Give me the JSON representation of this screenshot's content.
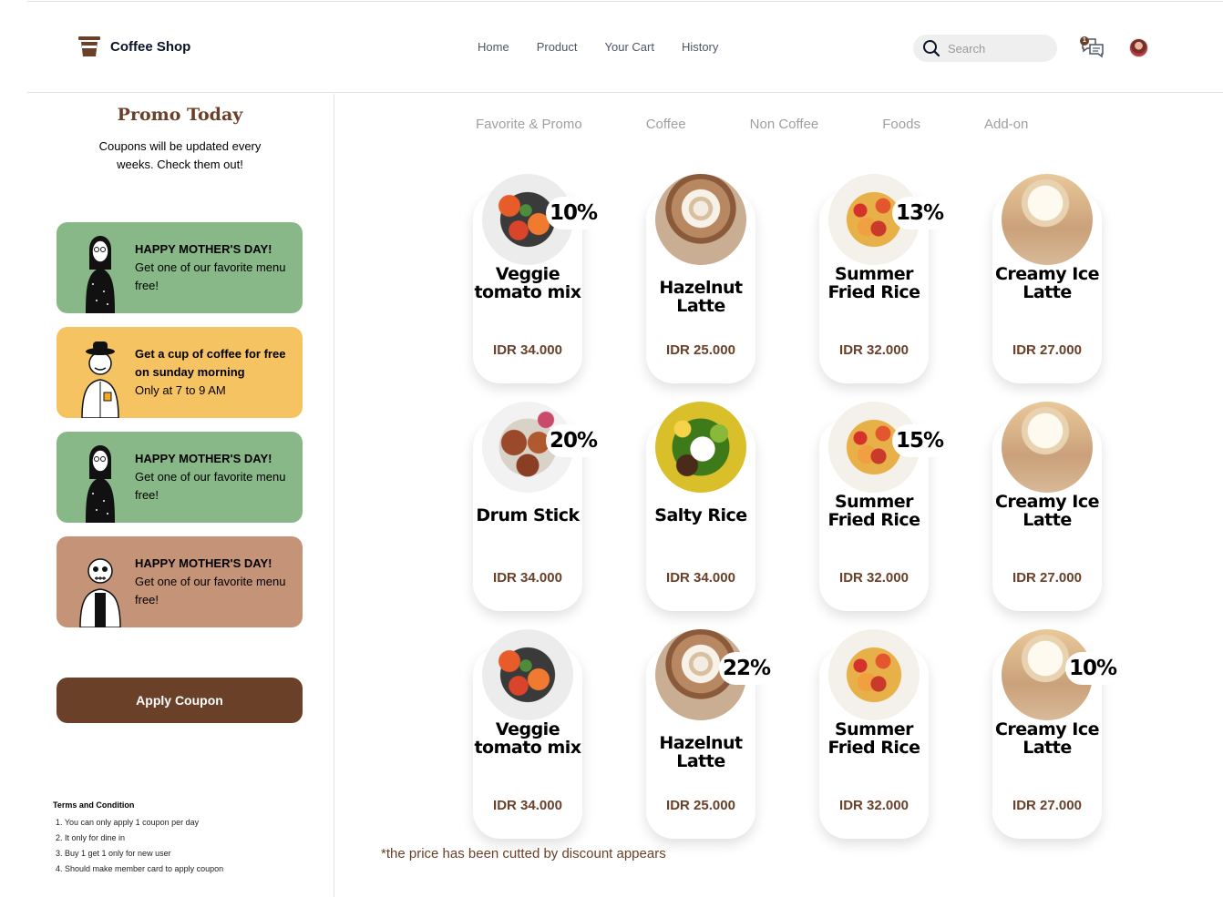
{
  "app": {
    "title": "Coffee Shop"
  },
  "nav": {
    "items": [
      "Home",
      "Product",
      "Your Cart",
      "History"
    ]
  },
  "search": {
    "placeholder": "Search"
  },
  "chat": {
    "badge": "1"
  },
  "promo": {
    "title": "Promo Today",
    "subtitle": "Coupons will be updated every weeks. Check them out!",
    "coupons": [
      {
        "head": "HAPPY MOTHER'S DAY!",
        "body": "Get one of our favorite menu free!",
        "color": "#88b788"
      },
      {
        "head": "Get a cup of coffee for free on sunday morning",
        "body": "Only at 7 to 9 AM",
        "color": "#f5c361"
      },
      {
        "head": "HAPPY MOTHER'S DAY!",
        "body": "Get one of our favorite menu free!",
        "color": "#88b788"
      },
      {
        "head": "HAPPY MOTHER'S DAY!",
        "body": "Get one of our favorite menu free!",
        "color": "#c59378"
      }
    ],
    "apply_label": "Apply Coupon"
  },
  "terms": {
    "title": "Terms and Condition",
    "items": [
      "1. You can only apply 1 coupon per day",
      "2. It only for dine in",
      "3. Buy 1 get 1 only for new user",
      "4. Should make member card to apply coupon"
    ]
  },
  "tabs": [
    "Favorite & Promo",
    "Coffee",
    "Non Coffee",
    "Foods",
    "Add-on"
  ],
  "products": [
    {
      "name": "Veggie tomato mix",
      "price": "IDR 34.000",
      "discount": "10%",
      "image": "veg"
    },
    {
      "name": "Hazelnut Latte",
      "price": "IDR 25.000",
      "discount": "",
      "image": "latte"
    },
    {
      "name": "Summer Fried Rice",
      "price": "IDR 32.000",
      "discount": "13%",
      "image": "rice"
    },
    {
      "name": "Creamy Ice Latte",
      "price": "IDR 27.000",
      "discount": "",
      "image": "icelatte"
    },
    {
      "name": "Drum Stick",
      "price": "IDR 34.000",
      "discount": "20%",
      "image": "drum"
    },
    {
      "name": "Salty Rice",
      "price": "IDR 34.000",
      "discount": "",
      "image": "salty"
    },
    {
      "name": "Summer Fried Rice",
      "price": "IDR 32.000",
      "discount": "15%",
      "image": "rice"
    },
    {
      "name": "Creamy Ice Latte",
      "price": "IDR 27.000",
      "discount": "",
      "image": "icelatte"
    },
    {
      "name": "Veggie tomato mix",
      "price": "IDR 34.000",
      "discount": "",
      "image": "veg"
    },
    {
      "name": "Hazelnut Latte",
      "price": "IDR 25.000",
      "discount": "22%",
      "image": "latte"
    },
    {
      "name": "Summer Fried Rice",
      "price": "IDR 32.000",
      "discount": "",
      "image": "rice"
    },
    {
      "name": "Creamy Ice Latte",
      "price": "IDR 27.000",
      "discount": "10%",
      "image": "icelatte"
    }
  ],
  "footnote": "*the price has been cutted by discount appears",
  "colors": {
    "brand": "#6a4029",
    "green": "#88b788",
    "yellow": "#f5c361",
    "tan": "#c59378"
  }
}
